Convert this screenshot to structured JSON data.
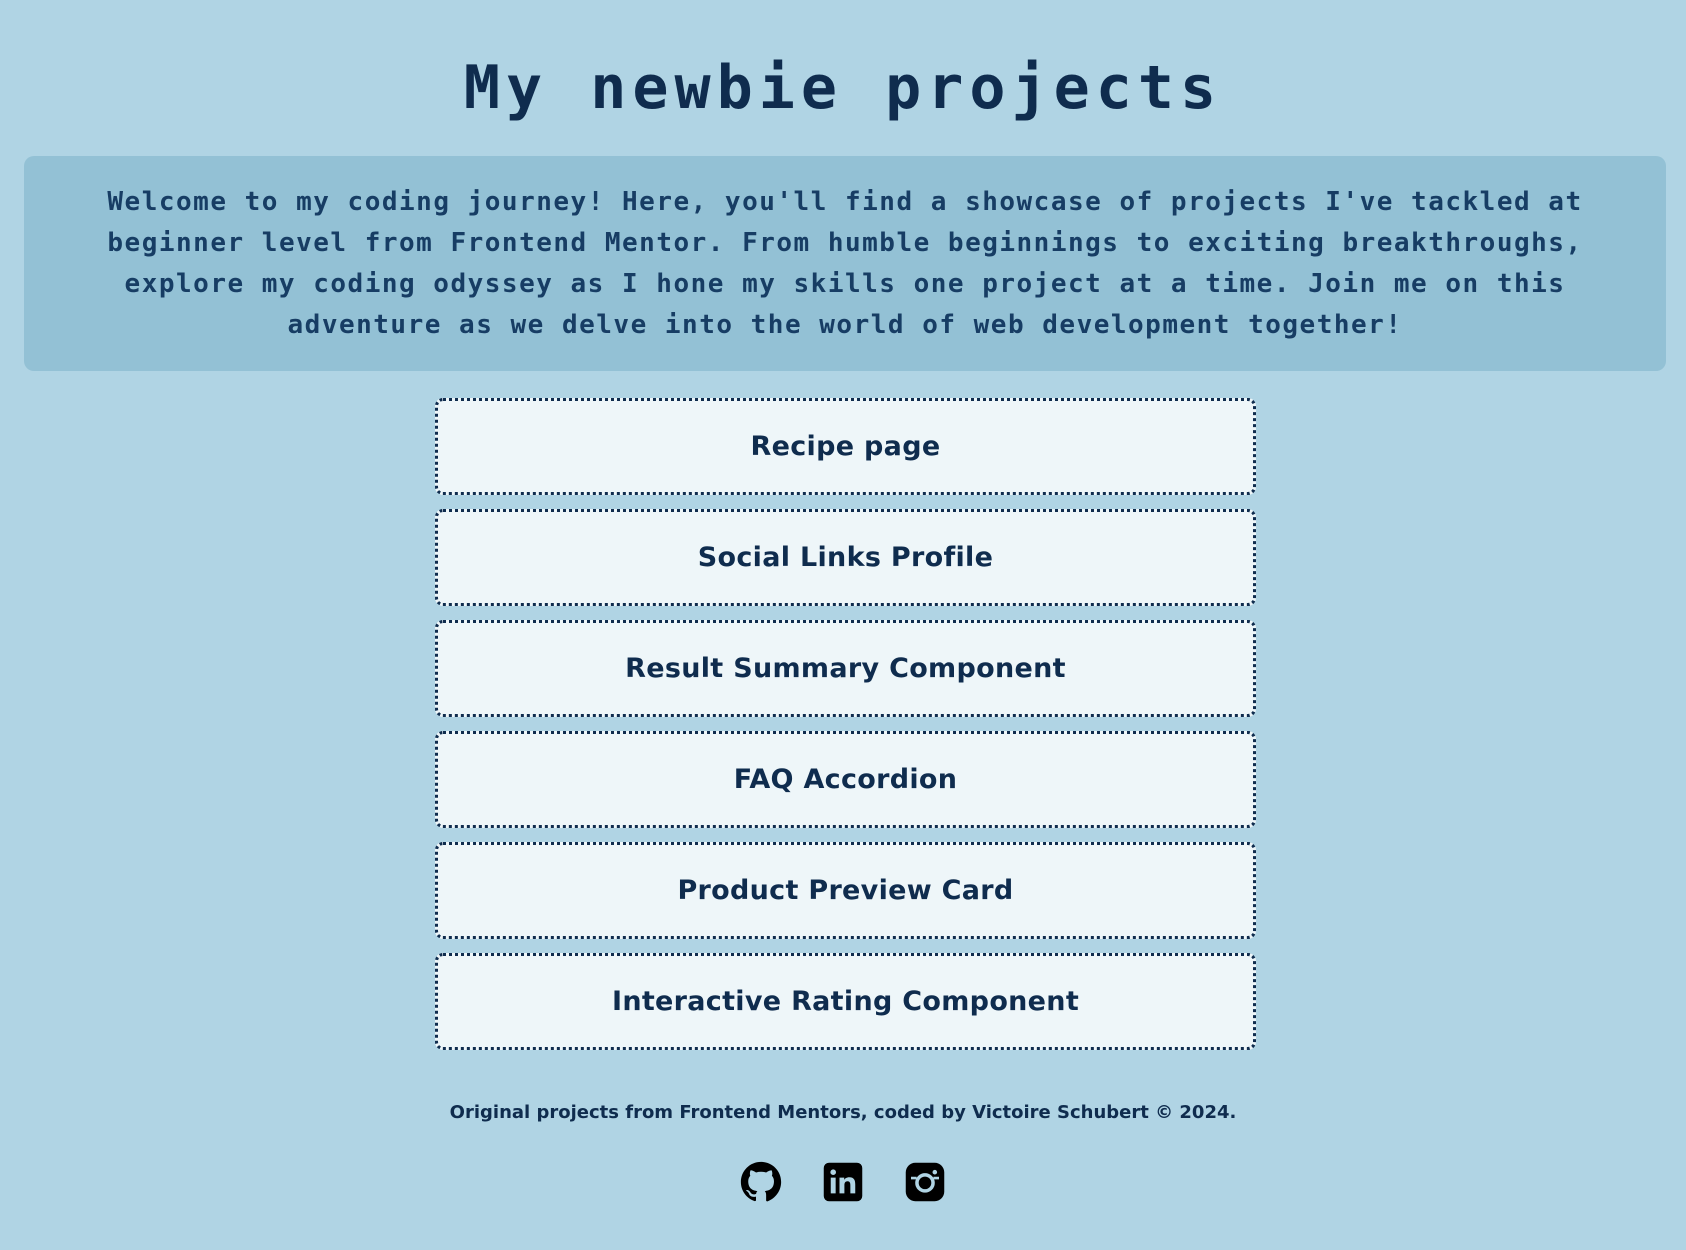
{
  "header": {
    "title": "My newbie projects"
  },
  "intro": {
    "text": "Welcome to my coding journey! Here, you'll find a showcase of projects I've tackled at beginner level from Frontend Mentor. From humble beginnings to exciting breakthroughs, explore my coding odyssey as I hone my skills one project at a time. Join me on this adventure as we delve into the world of web development together!"
  },
  "projects": [
    {
      "label": "Recipe page"
    },
    {
      "label": "Social Links Profile"
    },
    {
      "label": "Result Summary Component"
    },
    {
      "label": "FAQ Accordion"
    },
    {
      "label": "Product Preview Card"
    },
    {
      "label": "Interactive Rating Component"
    }
  ],
  "footer": {
    "text": "Original projects from Frontend Mentors, coded by Victoire Schubert © 2024.",
    "socials": [
      {
        "icon": "github-icon"
      },
      {
        "icon": "linkedin-icon"
      },
      {
        "icon": "instagram-icon"
      }
    ]
  },
  "colors": {
    "background": "#b0d4e4",
    "intro_background": "#93c1d5",
    "card_background": "#eef6f9",
    "text": "#0f2c4e"
  }
}
